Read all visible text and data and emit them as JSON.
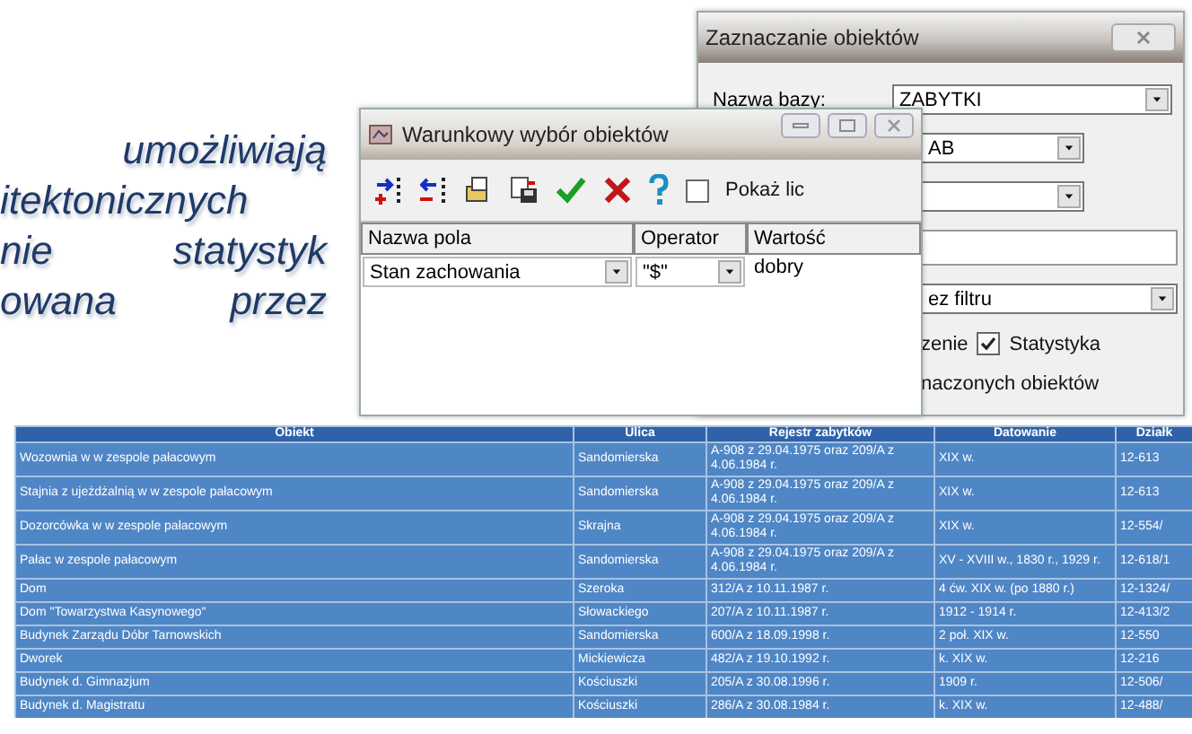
{
  "slide_text": {
    "lines": [
      "umożliwiają",
      "itektonicznych",
      "nie statystyk",
      "owana przez"
    ]
  },
  "selection_window": {
    "title": "Zaznaczanie obiektów",
    "database_label": "Nazwa bazy:",
    "database_value": "ZABYTKI",
    "layer_value": "AB",
    "filter_value": "ez filtru",
    "option_label": "zenie",
    "statistics": {
      "label": "Statystyka",
      "checked": true
    },
    "footer": "naczonych obiektów"
  },
  "conditional_window": {
    "title": "Warunkowy wybór obiektów",
    "show_checkbox": {
      "label": "Pokaż lic",
      "checked": false
    },
    "columns": [
      "Nazwa pola",
      "Operator",
      "Wartość"
    ],
    "rows": [
      {
        "field": "Stan zachowania",
        "operator": "\"$\"",
        "value": "dobry"
      }
    ]
  },
  "table": {
    "columns": [
      "Obiekt",
      "Ulica",
      "Rejestr zabytków",
      "Datowanie",
      "Działk"
    ],
    "rows": [
      [
        "Wozownia w w zespole pałacowym",
        "Sandomierska",
        "A-908 z 29.04.1975 oraz 209/A z 4.06.1984 r.",
        "XIX w.",
        "12-613"
      ],
      [
        "Stajnia z ujeżdżalnią w w zespole pałacowym",
        "Sandomierska",
        "A-908 z 29.04.1975 oraz 209/A z 4.06.1984 r.",
        "XIX w.",
        "12-613"
      ],
      [
        "Dozorcówka w w zespole pałacowym",
        "Skrajna",
        "A-908 z 29.04.1975 oraz 209/A z 4.06.1984 r.",
        "XIX w.",
        "12-554/"
      ],
      [
        "Pałac w zespole pałacowym",
        "Sandomierska",
        "A-908 z 29.04.1975 oraz 209/A z 4.06.1984 r.",
        "XV - XVIII w., 1830 r., 1929 r.",
        "12-618/1"
      ],
      [
        "Dom",
        "Szeroka",
        "312/A z 10.11.1987 r.",
        "4 ćw. XIX w. (po 1880 r.)",
        "12-1324/"
      ],
      [
        "Dom \"Towarzystwa Kasynowego\"",
        "Słowackiego",
        "207/A z 10.11.1987 r.",
        "1912 - 1914 r.",
        "12-413/2"
      ],
      [
        "Budynek Zarządu Dóbr Tarnowskich",
        "Sandomierska",
        "600/A z 18.09.1998 r.",
        "2 poł. XIX w.",
        "12-550"
      ],
      [
        "Dworek",
        "Mickiewicza",
        "482/A z 19.10.1992 r.",
        "k. XIX w.",
        "12-216"
      ],
      [
        "Budynek d. Gimnazjum",
        "Kościuszki",
        "205/A z 30.08.1996 r.",
        "1909 r.",
        "12-506/"
      ],
      [
        "Budynek d. Magistratu",
        "Kościuszki",
        "286/A z 30.08.1984 r.",
        "k. XIX w.",
        "12-488/"
      ]
    ]
  }
}
